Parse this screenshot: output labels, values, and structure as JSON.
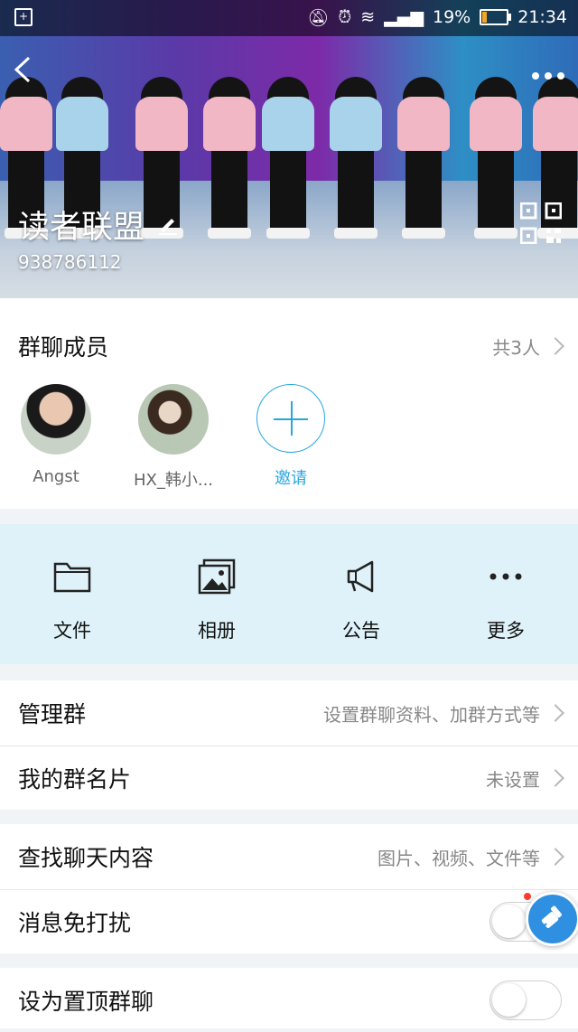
{
  "status_bar": {
    "battery": "19%",
    "time": "21:34"
  },
  "header": {
    "group_name": "读者联盟",
    "group_id": "938786112"
  },
  "members": {
    "title": "群聊成员",
    "count": "共3人",
    "list": [
      {
        "name": "Angst"
      },
      {
        "name": "HX_韩小..."
      }
    ],
    "invite_label": "邀请"
  },
  "tools": [
    {
      "label": "文件",
      "icon": "folder-icon"
    },
    {
      "label": "相册",
      "icon": "album-icon"
    },
    {
      "label": "公告",
      "icon": "megaphone-icon"
    },
    {
      "label": "更多",
      "icon": "more-dots-icon"
    }
  ],
  "settings": {
    "manage": {
      "label": "管理群",
      "value": "设置群聊资料、加群方式等"
    },
    "card": {
      "label": "我的群名片",
      "value": "未设置"
    },
    "search": {
      "label": "查找聊天内容",
      "value": "图片、视频、文件等"
    },
    "mute": {
      "label": "消息免打扰",
      "on": false
    },
    "pin": {
      "label": "设为置顶群聊",
      "on": false
    }
  },
  "colors": {
    "accent": "#27a6e0",
    "tools_bg": "#dff2f9"
  }
}
